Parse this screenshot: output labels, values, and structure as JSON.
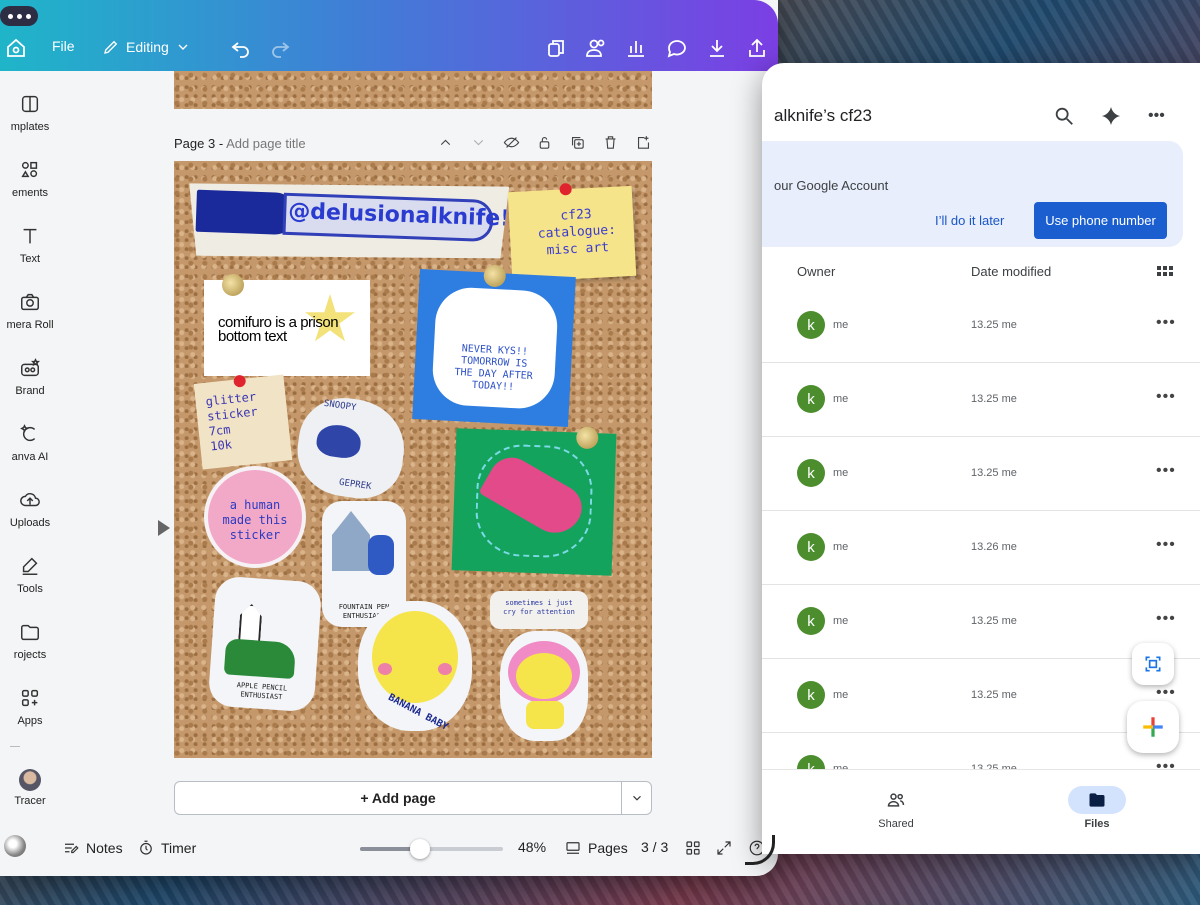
{
  "canva": {
    "toolbar": {
      "file": "File",
      "editing": "Editing"
    },
    "sidebar": [
      "mplates",
      "ements",
      "Text",
      "mera Roll",
      "Brand",
      "anva AI",
      "Uploads",
      "Tools",
      "rojects",
      "Apps",
      "Tracer"
    ],
    "page": {
      "title": "Page 3 -",
      "placeholder": "Add page title"
    },
    "add_page": "+ Add page",
    "bottom": {
      "notes": "Notes",
      "timer": "Timer",
      "zoom": "48%",
      "pages": "Pages",
      "page_count": "3 / 3",
      "zoom_fraction": 0.42
    },
    "stickers": {
      "handle": "@delusionalknife!",
      "note_line1": "cf23",
      "note_line2": "catalogue:",
      "note_line3": "misc art",
      "comifuro": "comifuro is a prison bottom text",
      "bear1": "NEVER KYS!!",
      "bear2": "TOMORROW IS",
      "bear3": "THE DAY AFTER",
      "bear4": "TODAY!!",
      "glitter1": "glitter",
      "glitter2": "sticker",
      "glitter3": "7cm",
      "glitter4": "10k",
      "snoopy": "SNOOPY",
      "geprek": "GEPREK",
      "human1": "a human",
      "human2": "made this",
      "human3": "sticker",
      "fountain1": "FOUNTAIN PEN",
      "fountain2": "ENTHUSIAST",
      "apple1": "APPLE PENCIL",
      "apple2": "ENTHUSIAST",
      "banana": "BANANA BABY",
      "cry1": "sometimes i just",
      "cry2": "cry for attention"
    }
  },
  "drive": {
    "title": "alknife’s cf23",
    "banner_text": "our Google Account",
    "later": "I’ll do it later",
    "phone": "Use phone number",
    "col_owner": "Owner",
    "col_date": "Date modified",
    "rows": [
      {
        "avatar": "k",
        "owner": "me",
        "date": "13.25 me"
      },
      {
        "avatar": "k",
        "owner": "me",
        "date": "13.25 me"
      },
      {
        "avatar": "k",
        "owner": "me",
        "date": "13.25 me"
      },
      {
        "avatar": "k",
        "owner": "me",
        "date": "13.26 me"
      },
      {
        "avatar": "k",
        "owner": "me",
        "date": "13.25 me"
      },
      {
        "avatar": "k",
        "owner": "me",
        "date": "13.25 me"
      },
      {
        "avatar": "k",
        "owner": "me",
        "date": "13.25 me"
      }
    ],
    "nav": {
      "shared": "Shared",
      "files": "Files"
    },
    "more": "•••"
  }
}
